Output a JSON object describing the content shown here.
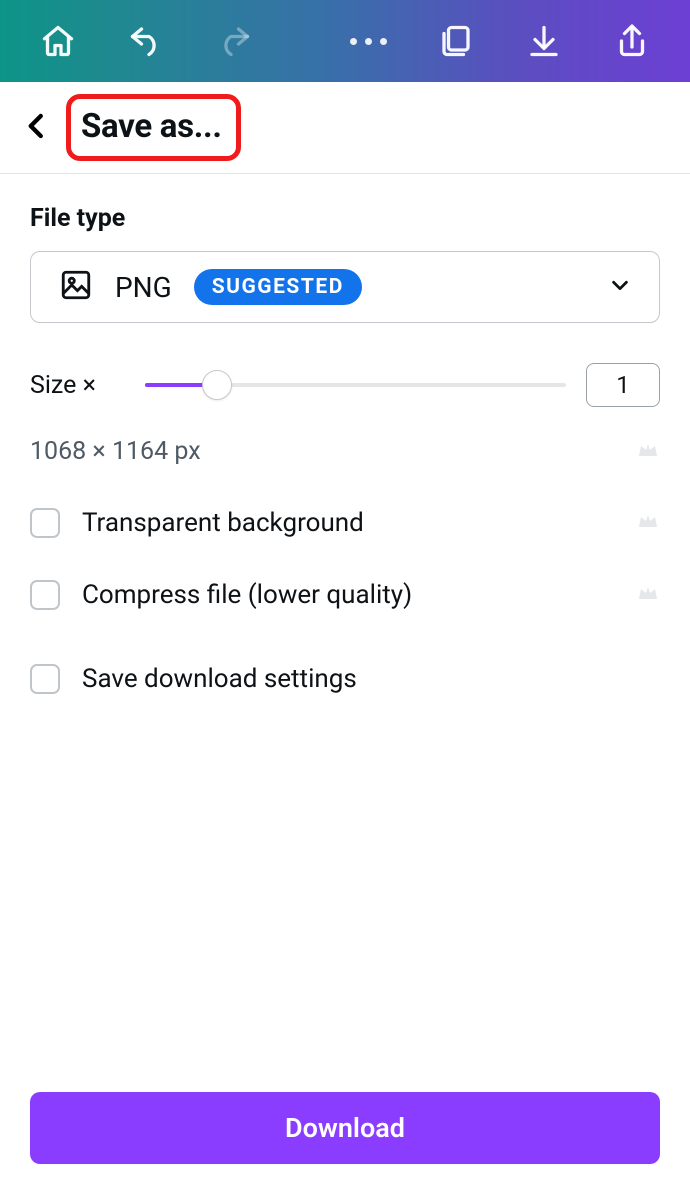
{
  "header": {
    "title": "Save as..."
  },
  "filetype": {
    "label": "File type",
    "value": "PNG",
    "badge": "SUGGESTED"
  },
  "size": {
    "label": "Size ×",
    "value": "1",
    "dimensions": "1068 × 1164 px"
  },
  "options": {
    "transparent": "Transparent background",
    "compress": "Compress file (lower quality)",
    "save_settings": "Save download settings"
  },
  "actions": {
    "download": "Download"
  }
}
